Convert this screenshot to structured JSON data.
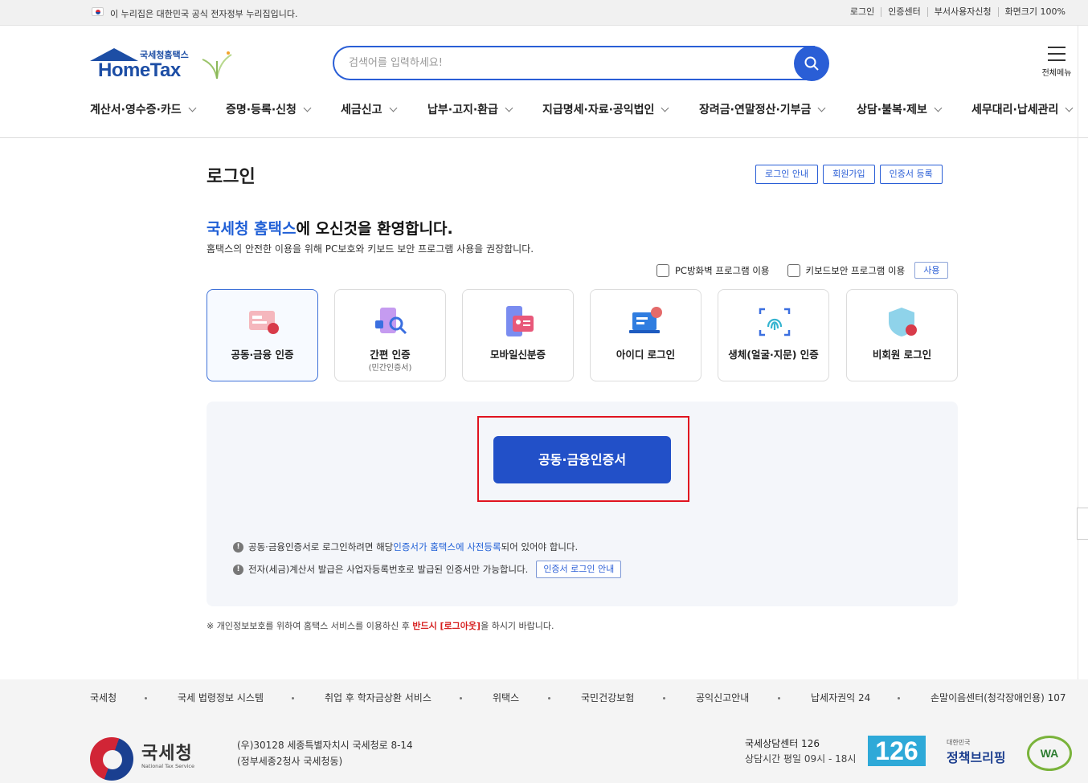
{
  "gov_bar": {
    "notice": "이 누리집은 대한민국 공식 전자정부 누리집입니다.",
    "links": [
      "로그인",
      "인증센터",
      "부서사용자신청",
      "화면크기 100%"
    ]
  },
  "logo": {
    "ko": "국세청홈택스",
    "en": "HomeTax"
  },
  "search": {
    "placeholder": "검색어를 입력하세요!"
  },
  "all_menu": {
    "label": "전체메뉴"
  },
  "gnb": [
    "계산서·영수증·카드",
    "증명·등록·신청",
    "세금신고",
    "납부·고지·환급",
    "지급명세·자료·공익법인",
    "장려금·연말정산·기부금",
    "상담·불복·제보",
    "세무대리·납세관리"
  ],
  "page": {
    "title": "로그인",
    "buttons": [
      "로그인 안내",
      "회원가입",
      "인증서 등록"
    ],
    "welcome_brand": "국세청 홈택스",
    "welcome_rest": "에 오신것을 환영합니다.",
    "subtitle": "홈택스의 안전한 이용을 위해 PC보호와 키보드 보안 프로그램 사용을 권장합니다.",
    "options": {
      "pc_firewall": "PC방화벽 프로그램 이용",
      "keyboard_security": "키보드보안 프로그램 이용",
      "use_button": "사용"
    }
  },
  "methods": [
    {
      "name": "공동·금융 인증",
      "sub": "",
      "icon": "certificate-icon"
    },
    {
      "name": "간편 인증",
      "sub": "(민간인증서)",
      "icon": "simple-auth-icon"
    },
    {
      "name": "모바일신분증",
      "sub": "",
      "icon": "mobile-id-icon"
    },
    {
      "name": "아이디 로그인",
      "sub": "",
      "icon": "id-login-icon"
    },
    {
      "name": "생체(얼굴·지문) 인증",
      "sub": "",
      "icon": "fingerprint-icon"
    },
    {
      "name": "비회원 로그인",
      "sub": "",
      "icon": "shield-icon"
    }
  ],
  "panel": {
    "cert_button": "공동·금융인증서",
    "note1_a": "공동·금융인증서로 로그인하려면 해당 ",
    "note1_link": "인증서가 홈택스에 사전등록",
    "note1_b": "되어 있어야 합니다.",
    "note2": "전자(세금)계산서 발급은 사업자등록번호로 발급된 인증서만 가능합니다.",
    "note2_button": "인증서 로그인 안내"
  },
  "privacy": {
    "a": "※ 개인정보보호를 위하여 홈택스 서비스를 이용하신 후 ",
    "red": "반드시 [로그아웃]",
    "b": "을 하시기 바랍니다."
  },
  "footer": {
    "links": [
      "국세청",
      "국세 법령정보 시스템",
      "취업 후 학자금상환 서비스",
      "위택스",
      "국민건강보험",
      "공익신고안내",
      "납세자권익 24",
      "손말이음센터(청각장애인용) 107"
    ],
    "org_name": "국세청",
    "org_en": "National Tax Service",
    "address1": "(우)30128 세종특별자치시 국세청로 8-14",
    "address2": "(정부세종2청사 국세청동)",
    "center": "국세상담센터 126",
    "hours": "상담시간 평일 09시 - 18시",
    "badge": "126",
    "policy_small": "대한민국",
    "policy_big": "정책브리핑",
    "wa": "WA"
  },
  "colors": {
    "brand_blue": "#2250c8",
    "highlight_red": "#e0131f"
  }
}
